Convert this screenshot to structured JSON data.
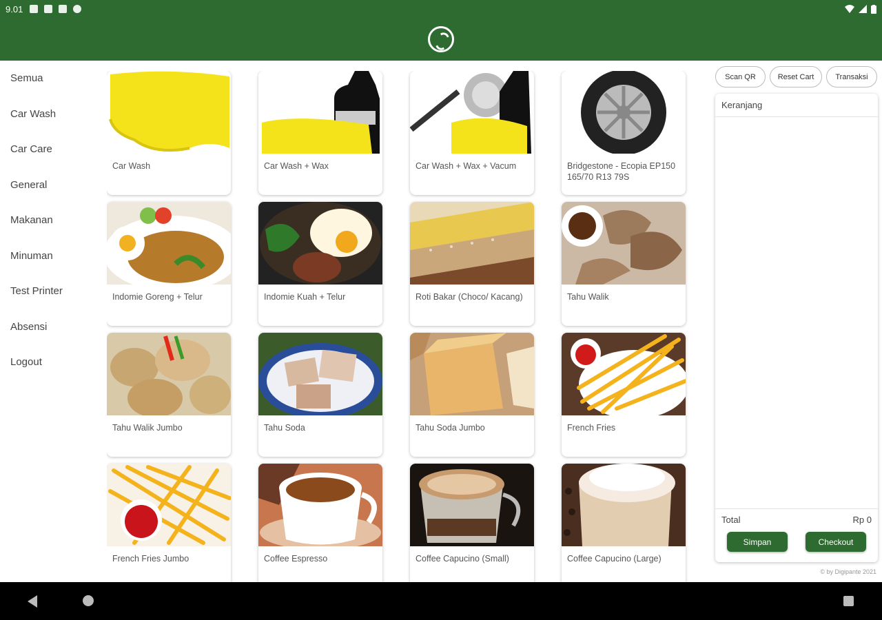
{
  "status": {
    "time": "9.01"
  },
  "sidebar": {
    "items": [
      {
        "label": "Semua"
      },
      {
        "label": "Car Wash"
      },
      {
        "label": "Car Care"
      },
      {
        "label": "General"
      },
      {
        "label": "Makanan"
      },
      {
        "label": "Minuman"
      },
      {
        "label": "Test Printer"
      },
      {
        "label": "Absensi"
      },
      {
        "label": "Logout"
      }
    ]
  },
  "products": [
    {
      "name": "Car Wash",
      "image": "yellow-sponge"
    },
    {
      "name": "Car Wash + Wax",
      "image": "sponge-and-wax-bottle"
    },
    {
      "name": "Car Wash + Wax + Vacum",
      "image": "vacuum-sponge-wax"
    },
    {
      "name": "Bridgestone - Ecopia EP150 165/70 R13 79S",
      "image": "tire"
    },
    {
      "name": "Indomie Goreng + Telur",
      "image": "fried-noodles-egg"
    },
    {
      "name": "Indomie Kuah + Telur",
      "image": "noodle-soup-egg"
    },
    {
      "name": "Roti Bakar (Choco/ Kacang)",
      "image": "toast"
    },
    {
      "name": "Tahu Walik",
      "image": "fried-tofu"
    },
    {
      "name": "Tahu Walik Jumbo",
      "image": "fried-tofu-chili"
    },
    {
      "name": "Tahu Soda",
      "image": "tofu-plate"
    },
    {
      "name": "Tahu Soda Jumbo",
      "image": "tofu-bread"
    },
    {
      "name": "French Fries",
      "image": "fries-ketchup"
    },
    {
      "name": "French Fries Jumbo",
      "image": "fries-ketchup-jumbo"
    },
    {
      "name": "Coffee Espresso",
      "image": "espresso-cup"
    },
    {
      "name": "Coffee Capucino (Small)",
      "image": "cappuccino-glass"
    },
    {
      "name": "Coffee Capucino (Large)",
      "image": "cappuccino-large"
    }
  ],
  "cart": {
    "buttons": {
      "scan": "Scan QR",
      "reset": "Reset Cart",
      "transaksi": "Transaksi"
    },
    "title": "Keranjang",
    "total_label": "Total",
    "total_value": "Rp 0",
    "save_label": "Simpan",
    "checkout_label": "Checkout",
    "copyright": "© by Digipante 2021"
  },
  "colors": {
    "primary": "#2e6b30"
  }
}
